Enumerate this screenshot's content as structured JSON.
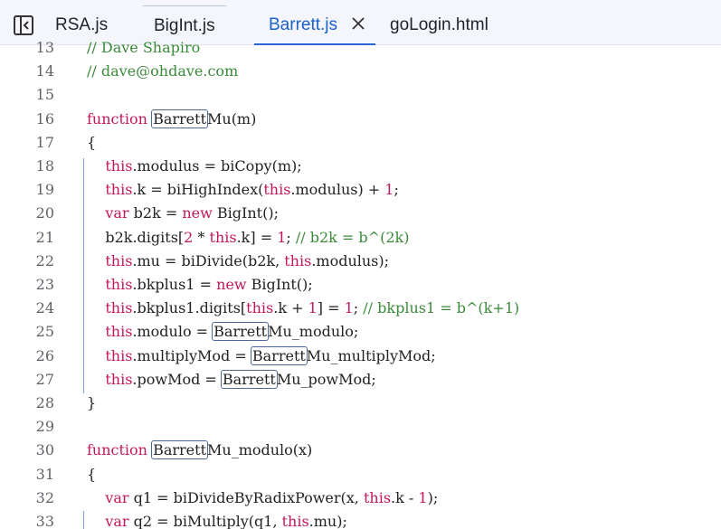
{
  "tabs": [
    {
      "label": "RSA.js"
    },
    {
      "label": "BigInt.js"
    },
    {
      "label": "Barrett.js"
    },
    {
      "label": "goLogin.html"
    }
  ],
  "editor": {
    "lines": [
      {
        "n": "13",
        "html": "<span class=\"cmt\">// Dave Shapiro</span>"
      },
      {
        "n": "14",
        "html": "<span class=\"cmt\">// dave@ohdave.com</span>"
      },
      {
        "n": "15",
        "html": ""
      },
      {
        "n": "16",
        "html": "<span class=\"kw\">function</span> <span class=\"tok-hl\">Barrett</span>Mu(m)"
      },
      {
        "n": "17",
        "html": "{"
      },
      {
        "n": "18",
        "html": "    <span class=\"kw\">this</span>.modulus = biCopy(m);"
      },
      {
        "n": "19",
        "html": "    <span class=\"kw\">this</span>.k = biHighIndex(<span class=\"kw\">this</span>.modulus) + <span class=\"num\">1</span>;"
      },
      {
        "n": "20",
        "html": "    <span class=\"kw\">var</span> b2k = <span class=\"kw\">new</span> BigInt();"
      },
      {
        "n": "21",
        "html": "    b2k.digits[<span class=\"num\">2</span> * <span class=\"kw\">this</span>.k] = <span class=\"num\">1</span>; <span class=\"cmt\">// b2k = b^(2k)</span>"
      },
      {
        "n": "22",
        "html": "    <span class=\"kw\">this</span>.mu = biDivide(b2k, <span class=\"kw\">this</span>.modulus);"
      },
      {
        "n": "23",
        "html": "    <span class=\"kw\">this</span>.bkplus1 = <span class=\"kw\">new</span> BigInt();"
      },
      {
        "n": "24",
        "html": "    <span class=\"kw\">this</span>.bkplus1.digits[<span class=\"kw\">this</span>.k + <span class=\"num\">1</span>] = <span class=\"num\">1</span>; <span class=\"cmt\">// bkplus1 = b^(k+1)</span>"
      },
      {
        "n": "25",
        "html": "    <span class=\"kw\">this</span>.modulo = <span class=\"tok-hl\">Barrett</span>Mu_modulo;"
      },
      {
        "n": "26",
        "html": "    <span class=\"kw\">this</span>.multiplyMod = <span class=\"tok-hl\">Barrett</span>Mu_multiplyMod;"
      },
      {
        "n": "27",
        "html": "    <span class=\"kw\">this</span>.powMod = <span class=\"tok-hl\">Barrett</span>Mu_powMod;"
      },
      {
        "n": "28",
        "html": "}"
      },
      {
        "n": "29",
        "html": ""
      },
      {
        "n": "30",
        "html": "<span class=\"kw\">function</span> <span class=\"tok-hl\">Barrett</span>Mu_modulo(x)"
      },
      {
        "n": "31",
        "html": "{"
      },
      {
        "n": "32",
        "html": "    <span class=\"kw\">var</span> q1 = biDivideByRadixPower(x, <span class=\"kw\">this</span>.k - <span class=\"num\">1</span>);"
      },
      {
        "n": "33",
        "html": "    <span class=\"kw\">var</span> q2 = biMultiply(q1, <span class=\"kw\">this</span>.mu);"
      }
    ]
  }
}
